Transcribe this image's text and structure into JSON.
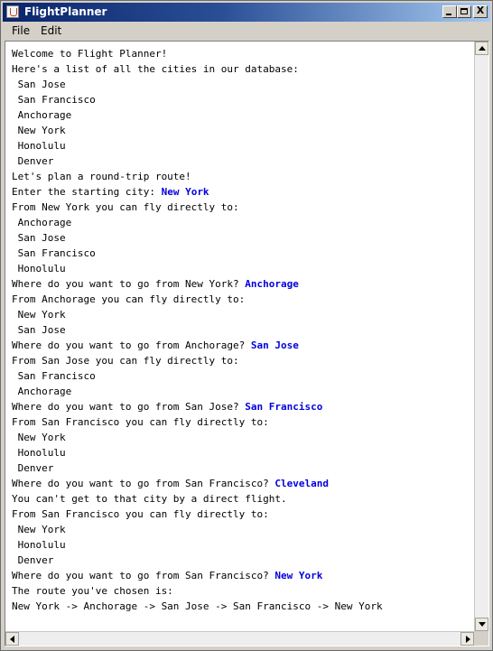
{
  "window": {
    "title": "FlightPlanner",
    "controls": {
      "minimize": "_",
      "maximize": "□",
      "close": "X"
    },
    "colors": {
      "titlebar_start": "#0a246a",
      "titlebar_end": "#a6caf0",
      "user_input": "#0000e0"
    }
  },
  "menu": {
    "items": [
      {
        "label": "File"
      },
      {
        "label": "Edit"
      }
    ]
  },
  "console": {
    "lines": [
      {
        "text": "Welcome to Flight Planner!",
        "input": ""
      },
      {
        "text": "Here's a list of all the cities in our database:",
        "input": ""
      },
      {
        "text": " San Jose",
        "input": ""
      },
      {
        "text": " San Francisco",
        "input": ""
      },
      {
        "text": " Anchorage",
        "input": ""
      },
      {
        "text": " New York",
        "input": ""
      },
      {
        "text": " Honolulu",
        "input": ""
      },
      {
        "text": " Denver",
        "input": ""
      },
      {
        "text": "Let's plan a round-trip route!",
        "input": ""
      },
      {
        "text": "Enter the starting city: ",
        "input": "New York"
      },
      {
        "text": "From New York you can fly directly to:",
        "input": ""
      },
      {
        "text": " Anchorage",
        "input": ""
      },
      {
        "text": " San Jose",
        "input": ""
      },
      {
        "text": " San Francisco",
        "input": ""
      },
      {
        "text": " Honolulu",
        "input": ""
      },
      {
        "text": "Where do you want to go from New York? ",
        "input": "Anchorage"
      },
      {
        "text": "From Anchorage you can fly directly to:",
        "input": ""
      },
      {
        "text": " New York",
        "input": ""
      },
      {
        "text": " San Jose",
        "input": ""
      },
      {
        "text": "Where do you want to go from Anchorage? ",
        "input": "San Jose"
      },
      {
        "text": "From San Jose you can fly directly to:",
        "input": ""
      },
      {
        "text": " San Francisco",
        "input": ""
      },
      {
        "text": " Anchorage",
        "input": ""
      },
      {
        "text": "Where do you want to go from San Jose? ",
        "input": "San Francisco"
      },
      {
        "text": "From San Francisco you can fly directly to:",
        "input": ""
      },
      {
        "text": " New York",
        "input": ""
      },
      {
        "text": " Honolulu",
        "input": ""
      },
      {
        "text": " Denver",
        "input": ""
      },
      {
        "text": "Where do you want to go from San Francisco? ",
        "input": "Cleveland"
      },
      {
        "text": "You can't get to that city by a direct flight.",
        "input": ""
      },
      {
        "text": "From San Francisco you can fly directly to:",
        "input": ""
      },
      {
        "text": " New York",
        "input": ""
      },
      {
        "text": " Honolulu",
        "input": ""
      },
      {
        "text": " Denver",
        "input": ""
      },
      {
        "text": "Where do you want to go from San Francisco? ",
        "input": "New York"
      },
      {
        "text": "The route you've chosen is:",
        "input": ""
      },
      {
        "text": "New York -> Anchorage -> San Jose -> San Francisco -> New York",
        "input": ""
      }
    ]
  }
}
